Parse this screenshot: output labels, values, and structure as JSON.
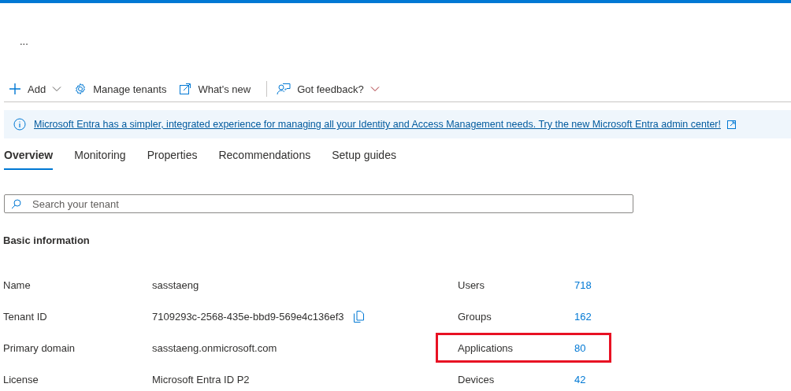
{
  "more_button": "...",
  "toolbar": [
    {
      "kind": "plus",
      "label": "Add",
      "dropdown": true
    },
    {
      "kind": "gear",
      "label": "Manage tenants",
      "dropdown": false
    },
    {
      "kind": "external",
      "label": "What's new",
      "dropdown": false
    },
    {
      "kind": "separator"
    },
    {
      "kind": "feedback",
      "label": "Got feedback?",
      "dropdown": true
    }
  ],
  "banner": {
    "text": "Microsoft Entra has a simpler, integrated experience for managing all your Identity and Access Management needs. Try the new Microsoft Entra admin center!"
  },
  "tabs": [
    {
      "label": "Overview",
      "selected": true
    },
    {
      "label": "Monitoring",
      "selected": false
    },
    {
      "label": "Properties",
      "selected": false
    },
    {
      "label": "Recommendations",
      "selected": false
    },
    {
      "label": "Setup guides",
      "selected": false
    }
  ],
  "search": {
    "placeholder": "Search your tenant"
  },
  "section_title": "Basic information",
  "properties": [
    {
      "label": "Name",
      "value": "sasstaeng",
      "copyable": false
    },
    {
      "label": "Tenant ID",
      "value": "7109293c-2568-435e-bbd9-569e4c136ef3",
      "copyable": true
    },
    {
      "label": "Primary domain",
      "value": "sasstaeng.onmicrosoft.com",
      "copyable": false
    },
    {
      "label": "License",
      "value": "Microsoft Entra ID P2",
      "copyable": false
    }
  ],
  "stats": [
    {
      "label": "Users",
      "value": "718",
      "highlighted": false
    },
    {
      "label": "Groups",
      "value": "162",
      "highlighted": false
    },
    {
      "label": "Applications",
      "value": "80",
      "highlighted": true
    },
    {
      "label": "Devices",
      "value": "42",
      "highlighted": false
    }
  ]
}
